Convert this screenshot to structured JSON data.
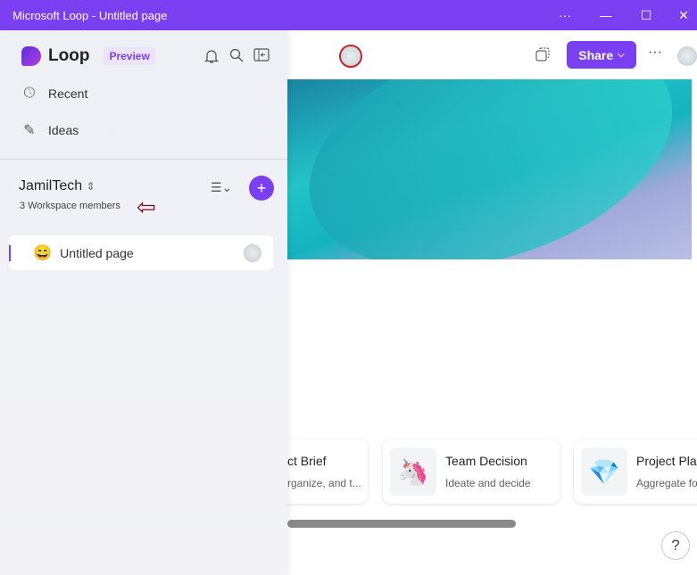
{
  "window": {
    "title": "Microsoft Loop - Untitled page",
    "controls": [
      "more",
      "minimize",
      "maximize",
      "close"
    ]
  },
  "header": {
    "share_label": "Share",
    "share_chevron": "⌵",
    "more_label": "···"
  },
  "sidebar": {
    "app_name": "Loop",
    "badge": "Preview",
    "nav": [
      {
        "label": "Recent",
        "icon": "clock-icon"
      },
      {
        "label": "Ideas",
        "icon": "pen-icon"
      }
    ],
    "workspace": {
      "name": "JamilTech",
      "members": "3 Workspace members"
    },
    "pages": [
      {
        "label": "Untitled page",
        "emoji": "😄"
      }
    ]
  },
  "templates": [
    {
      "title": "ct Brief",
      "subtitle": "rganize, and t..."
    },
    {
      "title": "Team Decision",
      "subtitle": "Ideate and decide",
      "emoji": "🦄"
    },
    {
      "title": "Project Pla",
      "subtitle": "Aggregate fo",
      "emoji": "💎"
    }
  ],
  "help_label": "?",
  "colors": {
    "accent": "#7b3ff2",
    "annotation_arrow": "#7a0c18"
  }
}
